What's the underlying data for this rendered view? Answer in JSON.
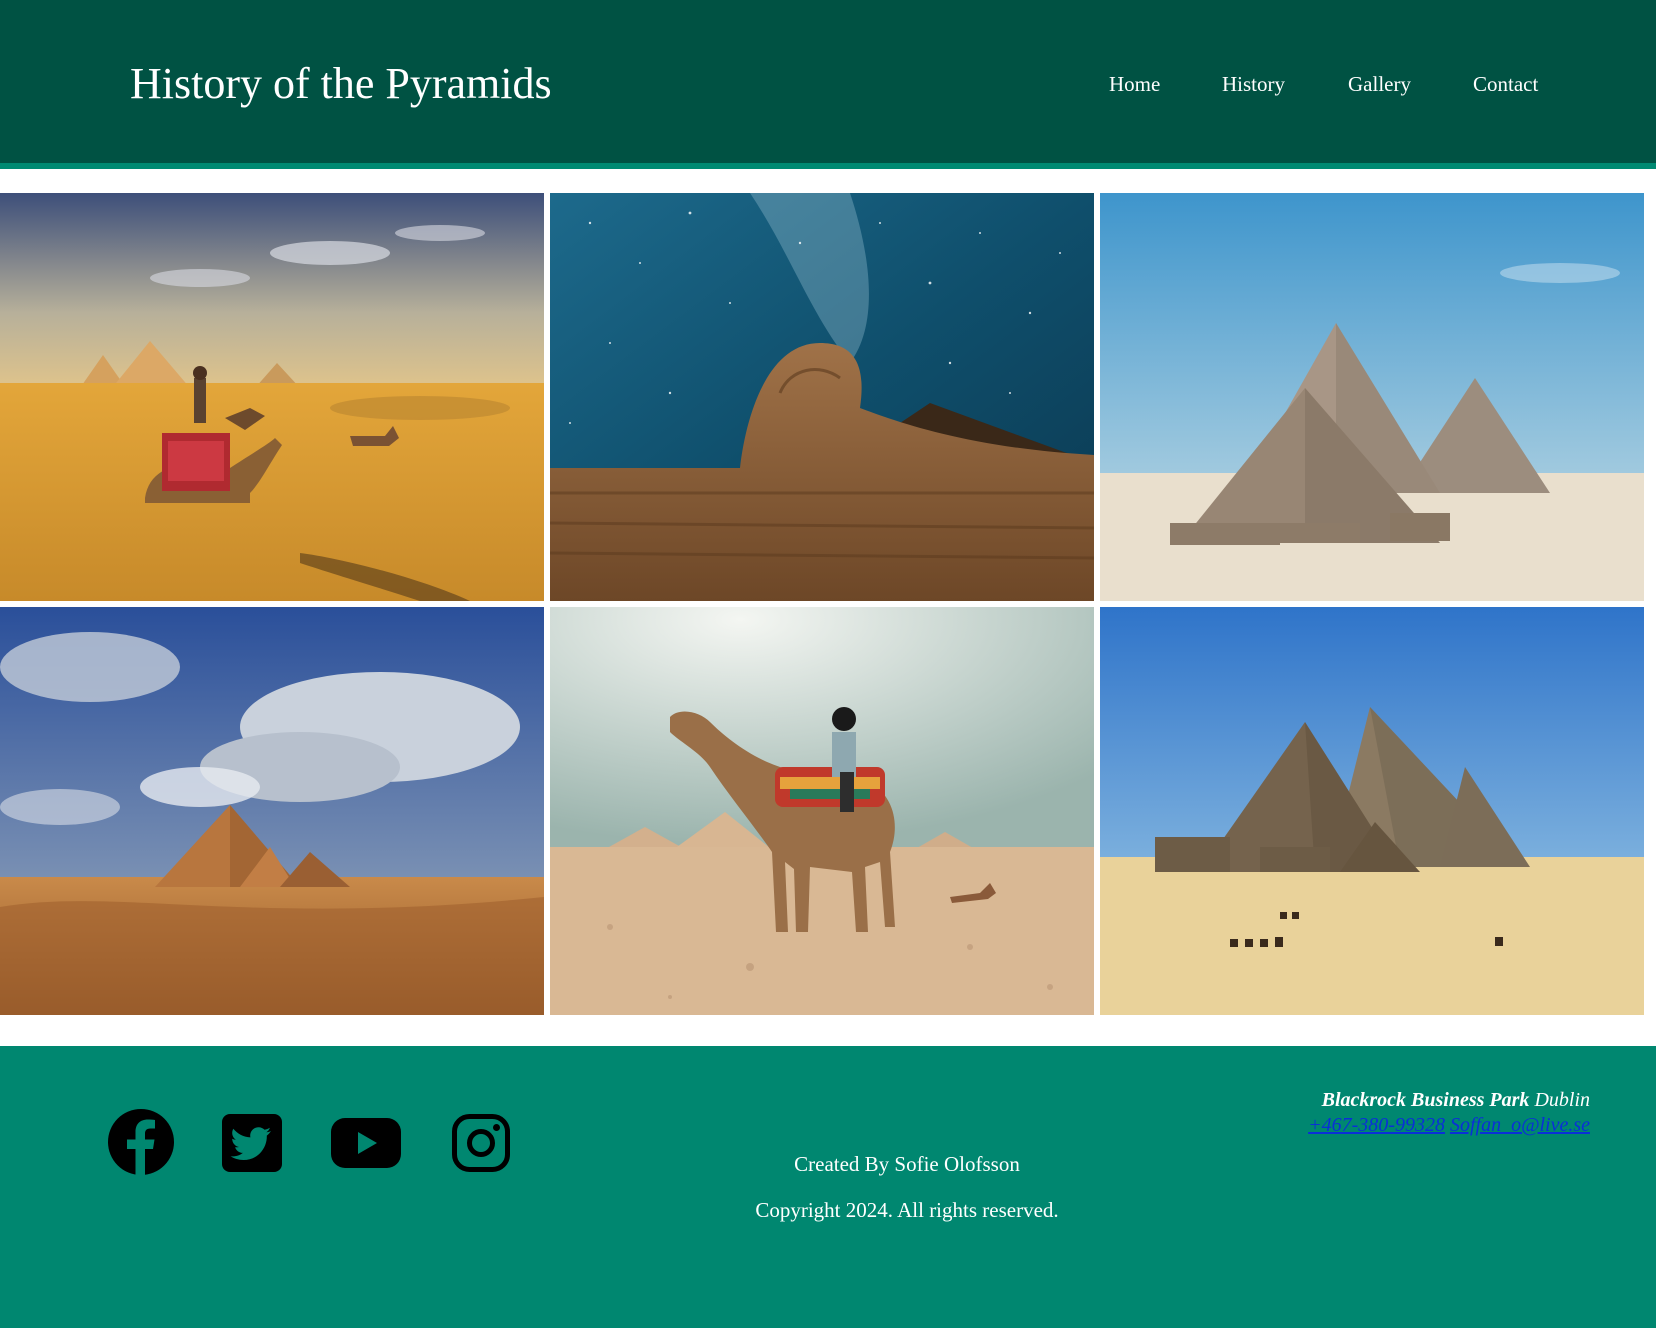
{
  "header": {
    "title": "History of the Pyramids",
    "nav": [
      "Home",
      "History",
      "Gallery",
      "Contact"
    ]
  },
  "gallery": {
    "images": [
      {
        "subject": "camels in desert with pyramids"
      },
      {
        "subject": "sphinx under starry night sky"
      },
      {
        "subject": "pyramids of Giza in sunlight"
      },
      {
        "subject": "pyramids under cloudy sky"
      },
      {
        "subject": "rider on camel in desert"
      },
      {
        "subject": "pyramids with camel caravan"
      }
    ]
  },
  "footer": {
    "social_icons": [
      "facebook-icon",
      "twitter-icon",
      "youtube-icon",
      "instagram-icon"
    ],
    "created_by": "Created By Sofie Olofsson",
    "copyright": "Copyright 2024. All rights reserved.",
    "address_place": "Blackrock Business Park",
    "address_city": "Dublin",
    "phone": "+467-380-99328",
    "email": "Soffan_o@live.se"
  },
  "colors": {
    "header_bg": "#005243",
    "accent": "#008a72",
    "footer_bg": "#008770",
    "link": "#0a2fd8"
  }
}
